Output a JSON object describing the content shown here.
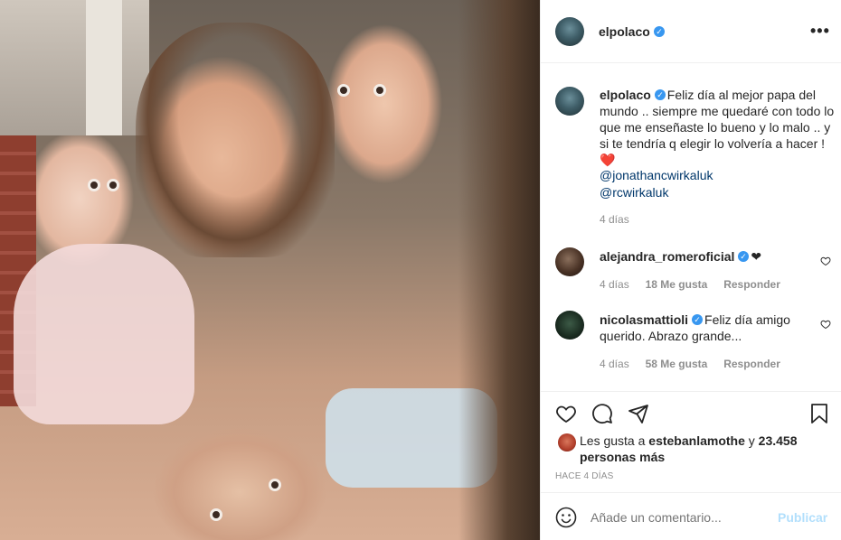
{
  "post": {
    "author": "elpolaco",
    "caption": "Feliz día al mejor papa del mundo .. siempre me quedaré con todo lo que me enseñaste lo bueno y lo malo .. y si te tendría q elegir lo volvería a hacer ! ❤️",
    "mentions": [
      "@jonathancwirkaluk",
      "@rcwirkaluk"
    ],
    "time": "4 días",
    "verified_mark": "✓",
    "more_label": "•••"
  },
  "comments": [
    {
      "user": "alejandra_romeroficial",
      "text": "❤",
      "time": "4 días",
      "likes": "18 Me gusta",
      "reply": "Responder"
    },
    {
      "user": "nicolasmattioli",
      "text": "Feliz día amigo querido. Abrazo grande...",
      "time": "4 días",
      "likes": "58 Me gusta",
      "reply": "Responder"
    }
  ],
  "likes_section": {
    "prefix": "Les gusta a",
    "user": "estebanlamothe",
    "connector": "y",
    "count": "23.458 personas más"
  },
  "ago": "HACE 4 DÍAS",
  "add_comment": {
    "placeholder": "Añade un comentario...",
    "post_label": "Publicar"
  },
  "icons": {
    "like": "heart-icon",
    "comment": "comment-icon",
    "share": "share-icon",
    "save": "bookmark-icon",
    "emoji": "emoji-icon",
    "more": "more-options-icon"
  },
  "colors": {
    "link": "#00376b",
    "verified": "#3897f0",
    "muted": "#8e8e8e",
    "post_disabled": "#b2dffc"
  }
}
